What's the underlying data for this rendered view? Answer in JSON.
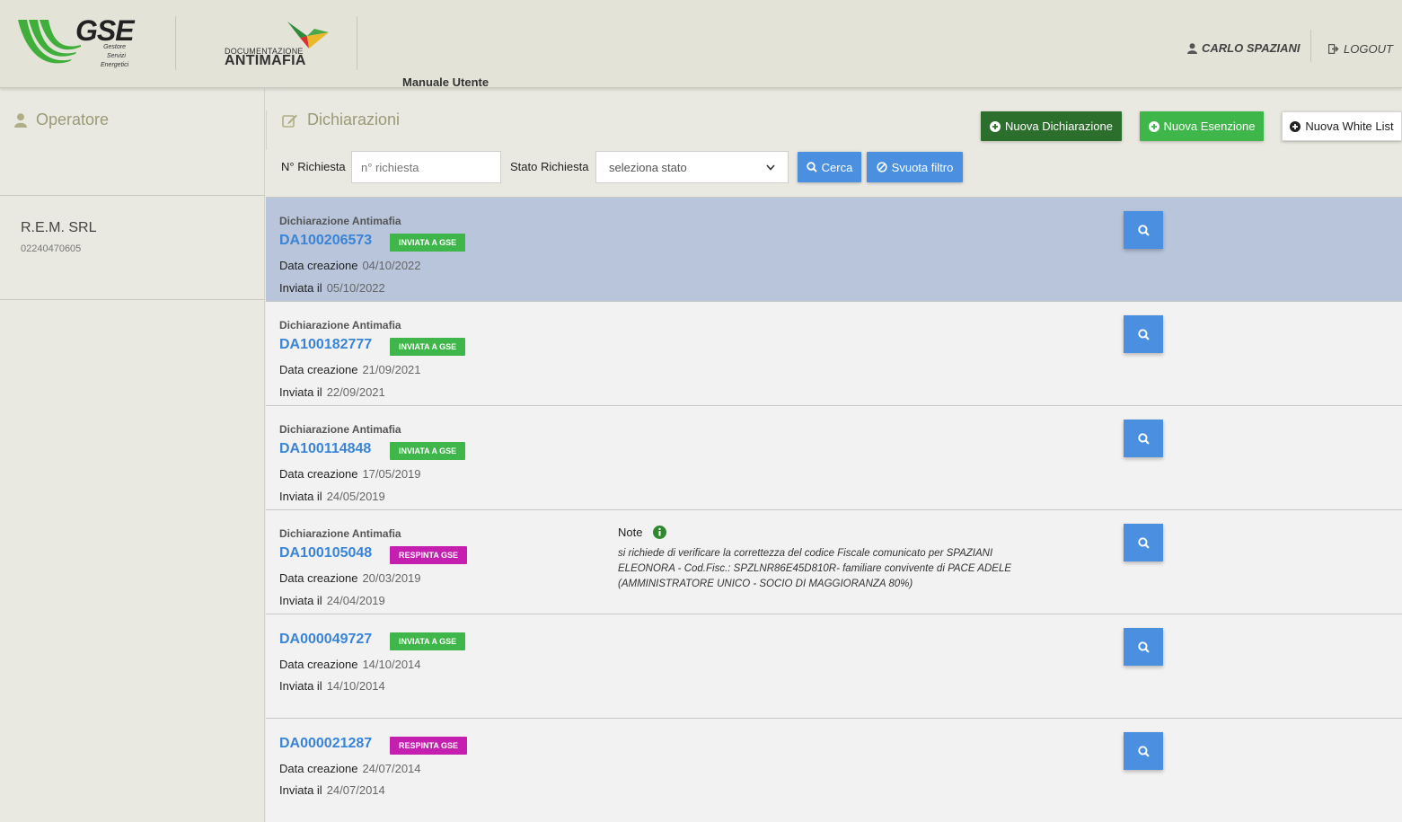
{
  "header": {
    "gse_logo_text": "GSE",
    "gse_logo_sub1": "Gestore",
    "gse_logo_sub2": "Servizi",
    "gse_logo_sub3": "Energetici",
    "antimafia_small": "DOCUMENTAZIONE",
    "antimafia_big": "ANTIMAFIA",
    "manual_link": "Manuale Utente",
    "user_name": "CARLO SPAZIANI",
    "logout_label": "LOGOUT"
  },
  "sidebar": {
    "title": "Operatore",
    "company_name": "R.E.M. SRL",
    "company_code": "02240470605"
  },
  "main": {
    "section_title": "Dichiarazioni",
    "buttons": {
      "new_declaration": "Nuova Dichiarazione",
      "new_exemption": "Nuova Esenzione",
      "new_whitelist": "Nuova White List"
    },
    "filters": {
      "request_number_label": "N° Richiesta",
      "request_number_placeholder": "n° richiesta",
      "status_label": "Stato Richiesta",
      "status_selected": "seleziona stato",
      "search_label": "Cerca",
      "clear_label": "Svuota filtro"
    },
    "labels": {
      "created": "Data creazione",
      "sent": "Inviata il",
      "note": "Note"
    },
    "rows": [
      {
        "kind": "Dichiarazione Antimafia",
        "code": "DA100206573",
        "status": "INVIATA A GSE",
        "created": "04/10/2022",
        "sent": "05/10/2022"
      },
      {
        "kind": "Dichiarazione Antimafia",
        "code": "DA100182777",
        "status": "INVIATA A GSE",
        "created": "21/09/2021",
        "sent": "22/09/2021"
      },
      {
        "kind": "Dichiarazione Antimafia",
        "code": "DA100114848",
        "status": "INVIATA A GSE",
        "created": "17/05/2019",
        "sent": "24/05/2019"
      },
      {
        "kind": "Dichiarazione Antimafia",
        "code": "DA100105048",
        "status": "RESPINTA GSE",
        "created": "20/03/2019",
        "sent": "24/04/2019",
        "note": "si richiede di verificare la correttezza del codice Fiscale comunicato per SPAZIANI ELEONORA - Cod.Fisc.: SPZLNR86E45D810R- familiare convivente di PACE ADELE (AMMINISTRATORE UNICO - SOCIO DI MAGGIORANZA 80%)"
      },
      {
        "kind": "",
        "code": "DA000049727",
        "status": "INVIATA A GSE",
        "created": "14/10/2014",
        "sent": "14/10/2014"
      },
      {
        "kind": "",
        "code": "DA000021287",
        "status": "RESPINTA GSE",
        "created": "24/07/2014",
        "sent": "24/07/2014"
      }
    ]
  },
  "colors": {
    "accent_blue": "#4a8fe0",
    "status_sent": "#3fb649",
    "status_rejected": "#c51fb0",
    "selected_row": "#b8c5da",
    "dark_green": "#2c6e2c"
  }
}
